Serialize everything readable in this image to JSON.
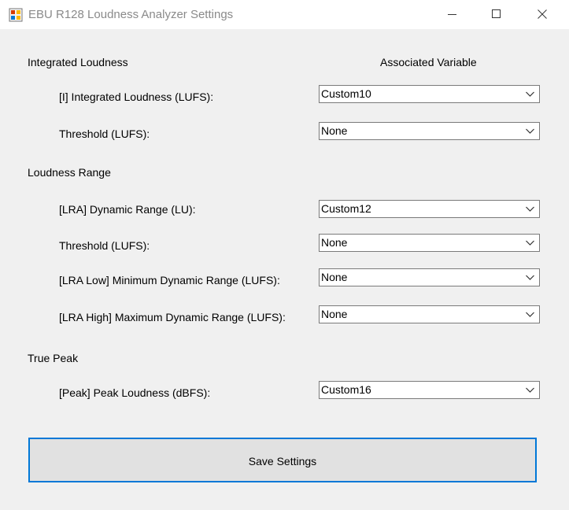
{
  "window": {
    "title": "EBU R128 Loudness Analyzer Settings"
  },
  "header": {
    "associated_variable": "Associated Variable"
  },
  "sections": [
    {
      "title": "Integrated Loudness",
      "fields": [
        {
          "label": "[I] Integrated Loudness (LUFS):",
          "value": "Custom10"
        },
        {
          "label": "Threshold (LUFS):",
          "value": "None"
        }
      ]
    },
    {
      "title": "Loudness Range",
      "fields": [
        {
          "label": "[LRA] Dynamic Range (LU):",
          "value": "Custom12"
        },
        {
          "label": "Threshold (LUFS):",
          "value": "None"
        },
        {
          "label": "[LRA Low] Minimum Dynamic Range (LUFS):",
          "value": "None"
        },
        {
          "label": "[LRA High] Maximum Dynamic Range (LUFS):",
          "value": "None"
        }
      ]
    },
    {
      "title": "True Peak",
      "fields": [
        {
          "label": "[Peak] Peak Loudness (dBFS):",
          "value": "Custom16"
        }
      ]
    }
  ],
  "save_button": {
    "label": "Save Settings"
  },
  "colors": {
    "focus_border": "#0078d7",
    "window_bg": "#f0f0f0"
  }
}
